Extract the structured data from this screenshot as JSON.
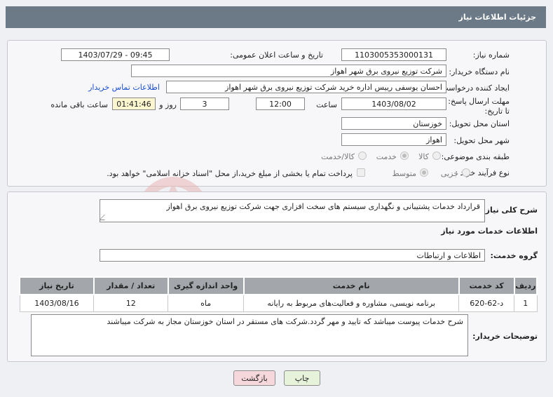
{
  "header": {
    "title": "جزئیات اطلاعات نیاز"
  },
  "form": {
    "need_number_label": "شماره نیاز:",
    "need_number": "1103005353000131",
    "announce_label": "تاریخ و ساعت اعلان عمومی:",
    "announce_value": "1403/07/29 - 09:45",
    "buyer_org_label": "نام دستگاه خریدار:",
    "buyer_org": "شرکت توزیع نیروی برق شهر اهواز",
    "requester_label": "ایجاد کننده درخواست:",
    "requester": "احسان یوسفی رییس اداره خرید شرکت توزیع نیروی برق شهر اهواز",
    "contact_link": "اطلاعات تماس خریدار",
    "deadline_label": "مهلت ارسال پاسخ: تا تاریخ:",
    "deadline_date": "1403/08/02",
    "time_label": "ساعت",
    "deadline_time": "12:00",
    "days_value": "3",
    "days_label": "روز و",
    "remaining_time": "01:41:46",
    "remaining_label": "ساعت باقی مانده",
    "province_label": "استان محل تحویل:",
    "province": "خوزستان",
    "city_label": "شهر محل تحویل:",
    "city": "اهواز",
    "category_label": "طبقه بندی موضوعی:",
    "category_options": [
      "کالا",
      "خدمت",
      "کالا/خدمت"
    ],
    "purchase_type_label": "نوع فرآیند خرید :",
    "purchase_options": [
      "جزیی",
      "متوسط"
    ],
    "payment_note": "پرداخت تمام یا بخشی از مبلغ خرید،از محل \"اسناد خزانه اسلامی\" خواهد بود."
  },
  "details": {
    "summary_label": "شرح کلی نیاز:",
    "summary": "قرارداد خدمات پشتیبانی و نگهداری سیستم های سخت افزاری جهت شرکت توزیع نیروی برق اهواز",
    "services_title": "اطلاعات خدمات مورد نیاز",
    "service_group_label": "گروه خدمت:",
    "service_group": "اطلاعات و ارتباطات",
    "table": {
      "headers": [
        "ردیف",
        "کد خدمت",
        "نام خدمت",
        "واحد اندازه گیری",
        "تعداد / مقدار",
        "تاریخ نیاز"
      ],
      "rows": [
        [
          "1",
          "د-62-620",
          "برنامه نویسی، مشاوره و فعالیت‌های مربوط به رایانه",
          "ماه",
          "12",
          "1403/08/16"
        ]
      ]
    },
    "buyer_notes_label": "توضیحات خریدار:",
    "buyer_notes": "شرح خدمات پیوست میباشد که تایید و مهر گردد.شرکت های مستقر در استان خوزستان مجاز به شرکت میباشند"
  },
  "buttons": {
    "print": "چاپ",
    "back": "بازگشت"
  },
  "colors": {
    "header_bg": "#6b7a86",
    "back_btn_bg": "#f6d7dc",
    "print_btn_bg": "#e6f2d9",
    "link": "#1a4fd1"
  }
}
